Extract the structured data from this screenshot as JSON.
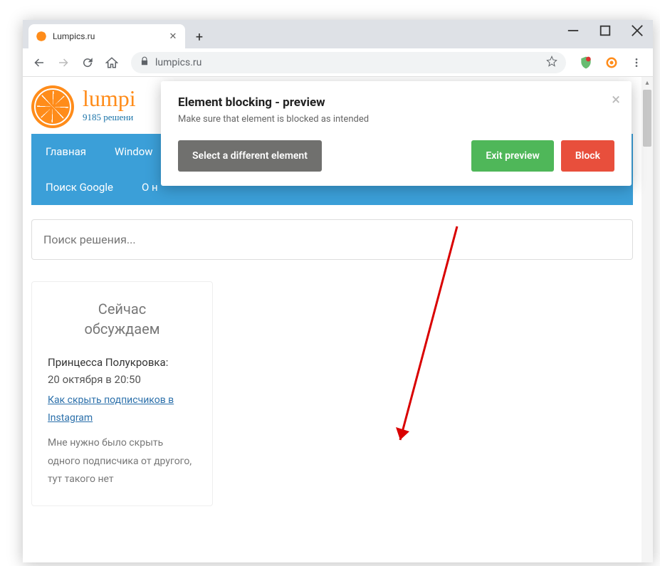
{
  "browser": {
    "tab_title": "Lumpics.ru",
    "url_display": "lumpics.ru"
  },
  "site": {
    "title": "lumpi",
    "subtitle": "9185 решени"
  },
  "nav": {
    "items": [
      "Главная",
      "Window"
    ],
    "items2": [
      "Поиск Google",
      "О н"
    ]
  },
  "search": {
    "placeholder": "Поиск решения..."
  },
  "sidebar": {
    "title_line1": "Сейчас",
    "title_line2": "обсуждаем",
    "comment": {
      "author": "Принцесса Полукровка:",
      "date": "20 октября в 20:50",
      "link": "Как скрыть подписчиков в Instagram",
      "text": "Мне нужно было скрыть одного подписчика от другого, тут такого нет"
    }
  },
  "modal": {
    "title": "Element blocking - preview",
    "subtitle": "Make sure that element is blocked as intended",
    "select_btn": "Select a different element",
    "exit_btn": "Exit preview",
    "block_btn": "Block"
  }
}
